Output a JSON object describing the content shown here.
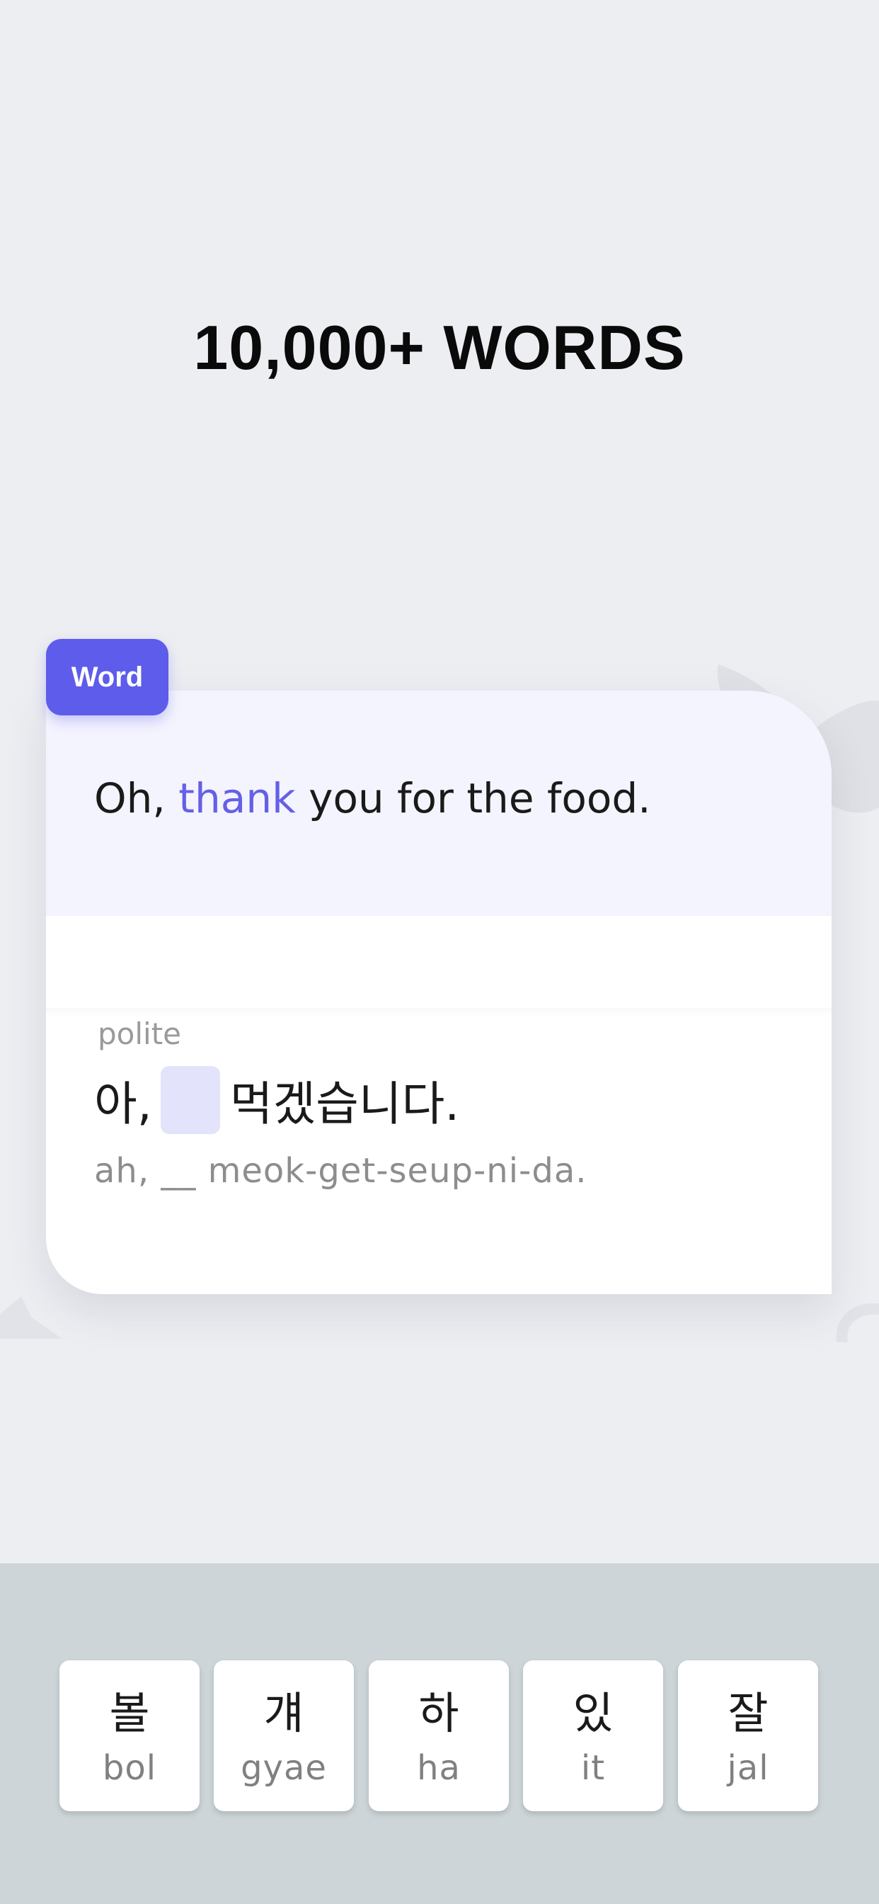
{
  "headline": "10,000+ WORDS",
  "card": {
    "tag": "Word",
    "english": {
      "before": "Oh, ",
      "highlight": "thank",
      "after": " you for the food."
    },
    "register": "polite",
    "korean": {
      "before": "아,",
      "after": "먹겠습니다."
    },
    "romanization": "ah, __ meok-get-seup-ni-da."
  },
  "keys": [
    {
      "char": "볼",
      "roman": "bol"
    },
    {
      "char": "걔",
      "roman": "gyae"
    },
    {
      "char": "하",
      "roman": "ha"
    },
    {
      "char": "있",
      "roman": "it"
    },
    {
      "char": "잘",
      "roman": "jal"
    }
  ],
  "colors": {
    "accent": "#5e5cea",
    "highlight_text": "#6560e6",
    "blank_fill": "#e3e3fb",
    "background": "#edeef2",
    "keyboard_bg": "#cdd5d8"
  }
}
